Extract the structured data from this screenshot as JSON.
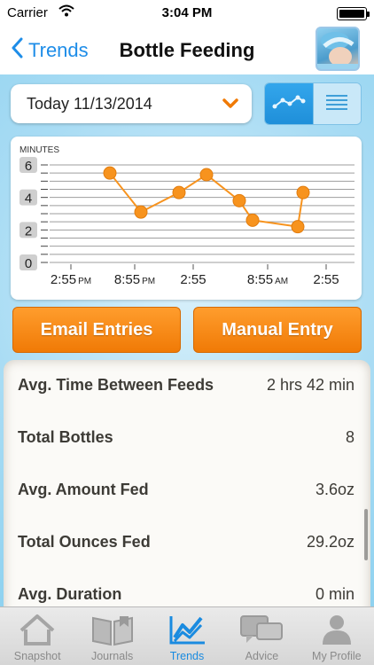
{
  "status": {
    "carrier": "Carrier",
    "time": "3:04 PM"
  },
  "nav": {
    "back_label": "Trends",
    "title": "Bottle Feeding"
  },
  "date_select": {
    "label": "Today 11/13/2014"
  },
  "chart_data": {
    "type": "line",
    "ylabel": "MINUTES",
    "y_ticks": [
      "0",
      "2",
      "4",
      "6"
    ],
    "x_ticks": [
      {
        "main": "2:55",
        "suffix": "PM"
      },
      {
        "main": "8:55",
        "suffix": "PM"
      },
      {
        "main": "2:55",
        "suffix": ""
      },
      {
        "main": "8:55",
        "suffix": "AM"
      },
      {
        "main": "2:55",
        "suffix": ""
      }
    ],
    "ylim": [
      0,
      6
    ],
    "values": [
      5.5,
      3.1,
      4.3,
      5.4,
      3.8,
      2.6,
      2.2,
      4.3
    ],
    "grid": true,
    "color": "#f7931e"
  },
  "buttons": {
    "email": "Email Entries",
    "manual": "Manual Entry"
  },
  "stats": [
    {
      "label": "Avg. Time Between Feeds",
      "value": "2 hrs 42 min"
    },
    {
      "label": "Total Bottles",
      "value": "8"
    },
    {
      "label": "Avg. Amount Fed",
      "value": "3.6oz"
    },
    {
      "label": "Total Ounces Fed",
      "value": "29.2oz"
    },
    {
      "label": "Avg. Duration",
      "value": "0 min"
    }
  ],
  "tabs": [
    {
      "label": "Snapshot",
      "icon": "house-icon"
    },
    {
      "label": "Journals",
      "icon": "book-icon"
    },
    {
      "label": "Trends",
      "icon": "trend-chart-icon"
    },
    {
      "label": "Advice",
      "icon": "chat-bubbles-icon"
    },
    {
      "label": "My Profile",
      "icon": "person-icon"
    }
  ],
  "colors": {
    "accent": "#1e8de8",
    "orange": "#f7931e"
  }
}
